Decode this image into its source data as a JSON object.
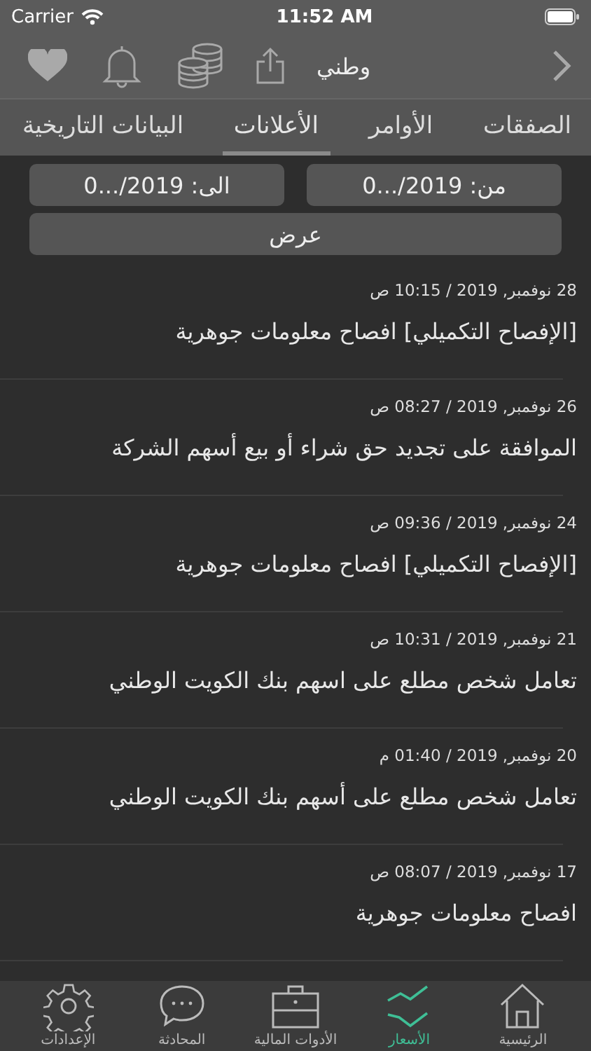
{
  "status_bar": {
    "carrier": "Carrier",
    "time": "11:52 AM"
  },
  "nav": {
    "title": "وطني"
  },
  "tabs": [
    {
      "label": "الصفقات",
      "selected": false
    },
    {
      "label": "الأوامر",
      "selected": false
    },
    {
      "label": "الأعلانات",
      "selected": true
    },
    {
      "label": "البيانات التاريخية",
      "selected": false
    }
  ],
  "filters": {
    "from": "من: 2019/...0",
    "to": "الى: 2019/...0",
    "show_button": "عرض"
  },
  "announcements": [
    {
      "date": "28 نوفمبر, 2019 / 10:15 ص",
      "title": "[الإفصاح التكميلي] افصاح معلومات جوهرية"
    },
    {
      "date": "26 نوفمبر, 2019 / 08:27 ص",
      "title": "الموافقة على تجديد حق شراء أو بيع أسهم الشركة"
    },
    {
      "date": "24 نوفمبر, 2019 / 09:36 ص",
      "title": "[الإفصاح التكميلي] افصاح معلومات جوهرية"
    },
    {
      "date": "21 نوفمبر, 2019 / 10:31 ص",
      "title": "تعامل شخص مطلع على اسهم بنك الكويت الوطني"
    },
    {
      "date": "20 نوفمبر, 2019 / 01:40 م",
      "title": "تعامل شخص مطلع على أسهم بنك الكويت الوطني"
    },
    {
      "date": "17 نوفمبر, 2019 / 08:07 ص",
      "title": "افصاح معلومات جوهرية"
    }
  ],
  "tab_bar": [
    {
      "kind": "home",
      "label": "الرئيسية",
      "selected": false
    },
    {
      "kind": "prices",
      "label": "الأسعار",
      "selected": true
    },
    {
      "kind": "tools",
      "label": "الأدوات المالية",
      "selected": false
    },
    {
      "kind": "chat",
      "label": "المحادثة",
      "selected": false
    },
    {
      "kind": "settings",
      "label": "الإعدادات",
      "selected": false
    }
  ]
}
